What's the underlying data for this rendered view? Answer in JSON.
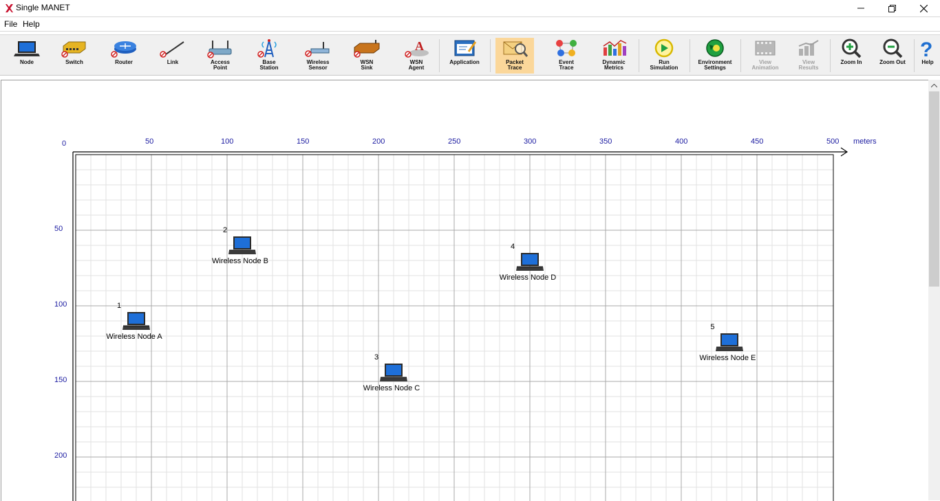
{
  "window": {
    "title": "Single MANET"
  },
  "menu": [
    "File",
    "Help"
  ],
  "toolbar": [
    {
      "label": "Node",
      "icon": "laptop-icon",
      "enabled": true
    },
    {
      "label": "Switch",
      "icon": "switch-icon",
      "enabled": true
    },
    {
      "label": "Router",
      "icon": "router-icon",
      "enabled": true
    },
    {
      "label": "Link",
      "icon": "link-icon",
      "enabled": true
    },
    {
      "label": "Access\nPoint",
      "icon": "access-point-icon",
      "enabled": true
    },
    {
      "label": "Base\nStation",
      "icon": "base-station-icon",
      "enabled": true
    },
    {
      "label": "Wireless\nSensor",
      "icon": "wireless-sensor-icon",
      "enabled": true
    },
    {
      "label": "WSN\nSink",
      "icon": "wsn-sink-icon",
      "enabled": true
    },
    {
      "label": "WSN\nAgent",
      "icon": "wsn-agent-icon",
      "enabled": true
    },
    {
      "label": "Application",
      "icon": "application-icon",
      "enabled": true
    },
    {
      "label": "Packet\nTrace",
      "icon": "packet-trace-icon",
      "enabled": true
    },
    {
      "label": "Event\nTrace",
      "icon": "event-trace-icon",
      "enabled": true
    },
    {
      "label": "Dynamic\nMetrics",
      "icon": "dynamic-metrics-icon",
      "enabled": true
    },
    {
      "label": "Run\nSimulation",
      "icon": "run-simulation-icon",
      "enabled": true
    },
    {
      "label": "Environment\nSettings",
      "icon": "environment-settings-icon",
      "enabled": true
    },
    {
      "label": "View\nAnimation",
      "icon": "view-animation-icon",
      "enabled": false
    },
    {
      "label": "View\nResults",
      "icon": "view-results-icon",
      "enabled": false
    },
    {
      "label": "Zoom In",
      "icon": "zoom-in-icon",
      "enabled": true
    },
    {
      "label": "Zoom Out",
      "icon": "zoom-out-icon",
      "enabled": true
    },
    {
      "label": "Help",
      "icon": "help-icon",
      "enabled": true
    }
  ],
  "grid": {
    "x_ticks": [
      "0",
      "50",
      "100",
      "150",
      "200",
      "250",
      "300",
      "350",
      "400",
      "450",
      "500"
    ],
    "x_unit": "meters",
    "y_ticks": [
      "50",
      "100",
      "150",
      "200"
    ]
  },
  "nodes": [
    {
      "id": "1",
      "name": "Wireless Node A",
      "x_m": 40,
      "y_m": 110
    },
    {
      "id": "2",
      "name": "Wireless Node B",
      "x_m": 110,
      "y_m": 60
    },
    {
      "id": "3",
      "name": "Wireless Node C",
      "x_m": 210,
      "y_m": 144
    },
    {
      "id": "4",
      "name": "Wireless Node D",
      "x_m": 300,
      "y_m": 71
    },
    {
      "id": "5",
      "name": "Wireless Node E",
      "x_m": 432,
      "y_m": 124
    }
  ],
  "colors": {
    "axis_label": "#1a1aa0",
    "grid_major": "#a8a8a8",
    "grid_minor": "#e2e2e2",
    "laptop_screen": "#1e6fd8"
  }
}
